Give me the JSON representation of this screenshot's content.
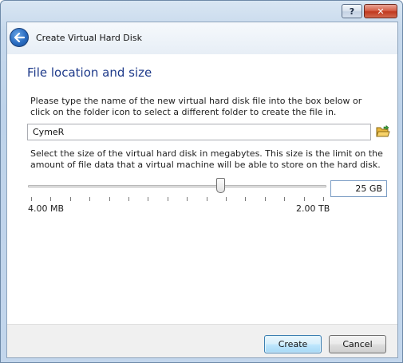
{
  "window": {
    "title": "Create Virtual Hard Disk",
    "help_label": "?",
    "close_label": "✕"
  },
  "page": {
    "heading": "File location and size",
    "location_description": "Please type the name of the new virtual hard disk file into the box below or click on the folder icon to select a different folder to create the file in.",
    "size_description": "Select the size of the virtual hard disk in megabytes. This size is the limit on the amount of file data that a virtual machine will be able to store on the hard disk."
  },
  "file_location": {
    "value": "CymeR",
    "folder_icon": "folder-open-icon"
  },
  "size": {
    "value": "25 GB",
    "min_label": "4.00 MB",
    "max_label": "2.00 TB",
    "slider_position": 0.65,
    "tick_count": 16
  },
  "buttons": {
    "create_label": "Create",
    "cancel_label": "Cancel"
  },
  "colors": {
    "heading": "#1e3a8a",
    "close_button": "#c0391f",
    "back_button": "#2a6cc1",
    "folder_icon": "#e8b63c"
  }
}
